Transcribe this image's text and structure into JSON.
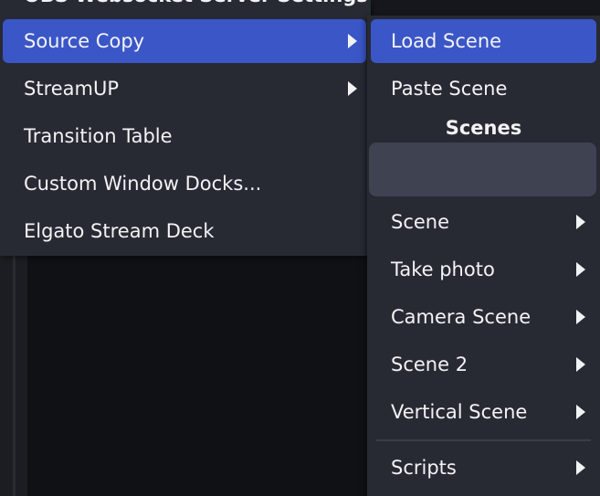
{
  "main_menu": {
    "cut_item": "OBS Websocket Server Settings",
    "items": [
      {
        "label": "Source Copy",
        "has_submenu": true,
        "active": true
      },
      {
        "label": "StreamUP",
        "has_submenu": true,
        "active": false
      },
      {
        "label": "Transition Table",
        "has_submenu": false,
        "active": false
      },
      {
        "label": "Custom Window Docks...",
        "has_submenu": false,
        "active": false
      },
      {
        "label": "Elgato Stream Deck",
        "has_submenu": false,
        "active": false
      }
    ]
  },
  "sub_menu": {
    "items": [
      {
        "label": "Load Scene",
        "active": true
      },
      {
        "label": "Paste Scene",
        "active": false
      }
    ],
    "section_header": "Scenes",
    "search": {
      "value": "",
      "placeholder": ""
    },
    "scenes": [
      {
        "label": "Scene",
        "has_submenu": true
      },
      {
        "label": "Take photo",
        "has_submenu": true
      },
      {
        "label": "Camera Scene",
        "has_submenu": true
      },
      {
        "label": "Scene 2",
        "has_submenu": true
      },
      {
        "label": "Vertical Scene",
        "has_submenu": true
      }
    ],
    "scripts": {
      "label": "Scripts",
      "has_submenu": true
    }
  },
  "colors": {
    "menu_bg": "#272a33",
    "highlight": "#3a56c7",
    "search_bg": "#3f4250",
    "text": "#f2f3f5",
    "background": "#16171c"
  },
  "icons": {
    "submenu_arrow": "chevron-right-icon"
  }
}
